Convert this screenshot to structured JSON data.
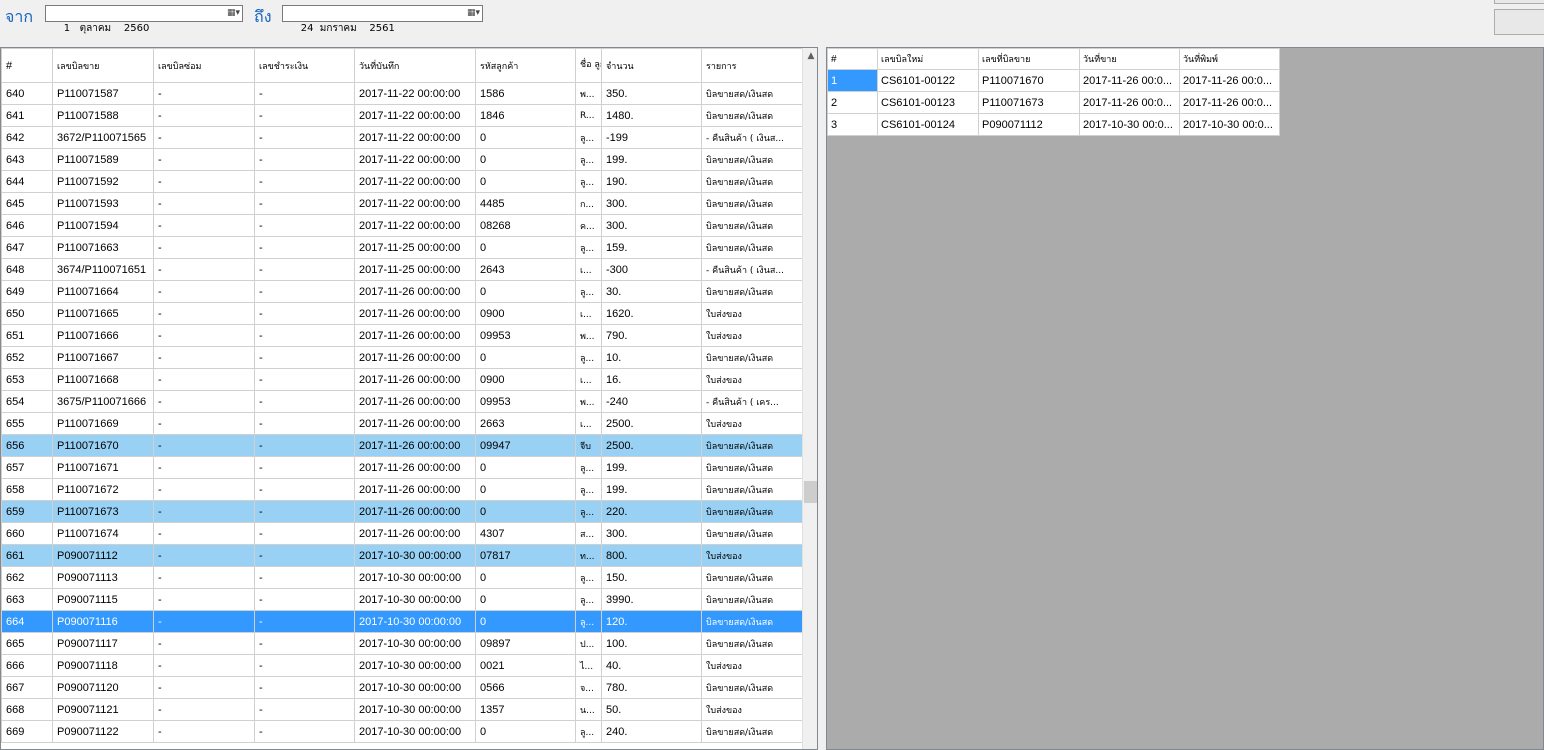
{
  "filter": {
    "from_label": "จาก",
    "from_date": "1   ตุลาคม    2560",
    "to_label": "ถึง",
    "to_date": "24  มกราคม    2561",
    "cal_icon": "▦▾"
  },
  "left_table": {
    "headers": [
      "#",
      "เลขบิลขาย",
      "เลขบิลซ่อม",
      "เลขชำระเงิน",
      "วันที่บันทึก",
      "รหัสลูกค้า",
      "ชื่อ ลูกค้",
      "จำนวน",
      "รายการ"
    ],
    "rows": [
      [
        "640",
        "P110071587",
        "-",
        "-",
        "2017-11-22 00:00:00",
        "1586",
        "พ...",
        "350.",
        "บิลขายสด/เงินสด"
      ],
      [
        "641",
        "P110071588",
        "-",
        "-",
        "2017-11-22 00:00:00",
        "1846",
        "R...",
        "1480.",
        "บิลขายสด/เงินสด"
      ],
      [
        "642",
        "3672/P110071565",
        "-",
        "-",
        "2017-11-22 00:00:00",
        "0",
        "ลู...",
        "-199",
        "- คืนสินค้า ( เงินส..."
      ],
      [
        "643",
        "P110071589",
        "-",
        "-",
        "2017-11-22 00:00:00",
        "0",
        "ลู...",
        "199.",
        "บิลขายสด/เงินสด"
      ],
      [
        "644",
        "P110071592",
        "-",
        "-",
        "2017-11-22 00:00:00",
        "0",
        "ลู...",
        "190.",
        "บิลขายสด/เงินสด"
      ],
      [
        "645",
        "P110071593",
        "-",
        "-",
        "2017-11-22 00:00:00",
        "4485",
        "ก...",
        "300.",
        "บิลขายสด/เงินสด"
      ],
      [
        "646",
        "P110071594",
        "-",
        "-",
        "2017-11-22 00:00:00",
        "08268",
        "ค...",
        "300.",
        "บิลขายสด/เงินสด"
      ],
      [
        "647",
        "P110071663",
        "-",
        "-",
        "2017-11-25 00:00:00",
        "0",
        "ลู...",
        "159.",
        "บิลขายสด/เงินสด"
      ],
      [
        "648",
        "3674/P110071651",
        "-",
        "-",
        "2017-11-25 00:00:00",
        "2643",
        "เ...",
        "-300",
        "- คืนสินค้า ( เงินส..."
      ],
      [
        "649",
        "P110071664",
        "-",
        "-",
        "2017-11-26 00:00:00",
        "0",
        "ลู...",
        "30.",
        "บิลขายสด/เงินสด"
      ],
      [
        "650",
        "P110071665",
        "-",
        "-",
        "2017-11-26 00:00:00",
        "0900",
        "เ...",
        "1620.",
        "ใบส่งของ"
      ],
      [
        "651",
        "P110071666",
        "-",
        "-",
        "2017-11-26 00:00:00",
        "09953",
        "พ...",
        "790.",
        "ใบส่งของ"
      ],
      [
        "652",
        "P110071667",
        "-",
        "-",
        "2017-11-26 00:00:00",
        "0",
        "ลู...",
        "10.",
        "บิลขายสด/เงินสด"
      ],
      [
        "653",
        "P110071668",
        "-",
        "-",
        "2017-11-26 00:00:00",
        "0900",
        "เ...",
        "16.",
        "ใบส่งของ"
      ],
      [
        "654",
        "3675/P110071666",
        "-",
        "-",
        "2017-11-26 00:00:00",
        "09953",
        "พ...",
        "-240",
        "- คืนสินค้า ( เคร..."
      ],
      [
        "655",
        "P110071669",
        "-",
        "-",
        "2017-11-26 00:00:00",
        "2663",
        "เ...",
        "2500.",
        "ใบส่งของ"
      ],
      [
        "656",
        "P110071670",
        "-",
        "-",
        "2017-11-26 00:00:00",
        "09947",
        "จีบ",
        "2500.",
        "บิลขายสด/เงินสด"
      ],
      [
        "657",
        "P110071671",
        "-",
        "-",
        "2017-11-26 00:00:00",
        "0",
        "ลู...",
        "199.",
        "บิลขายสด/เงินสด"
      ],
      [
        "658",
        "P110071672",
        "-",
        "-",
        "2017-11-26 00:00:00",
        "0",
        "ลู...",
        "199.",
        "บิลขายสด/เงินสด"
      ],
      [
        "659",
        "P110071673",
        "-",
        "-",
        "2017-11-26 00:00:00",
        "0",
        "ลู...",
        "220.",
        "บิลขายสด/เงินสด"
      ],
      [
        "660",
        "P110071674",
        "-",
        "-",
        "2017-11-26 00:00:00",
        "4307",
        "ส...",
        "300.",
        "บิลขายสด/เงินสด"
      ],
      [
        "661",
        "P090071112",
        "-",
        "-",
        "2017-10-30 00:00:00",
        "07817",
        "ท...",
        "800.",
        "ใบส่งของ"
      ],
      [
        "662",
        "P090071113",
        "-",
        "-",
        "2017-10-30 00:00:00",
        "0",
        "ลู...",
        "150.",
        "บิลขายสด/เงินสด"
      ],
      [
        "663",
        "P090071115",
        "-",
        "-",
        "2017-10-30 00:00:00",
        "0",
        "ลู...",
        "3990.",
        "บิลขายสด/เงินสด"
      ],
      [
        "664",
        "P090071116",
        "-",
        "-",
        "2017-10-30 00:00:00",
        "0",
        "ลู...",
        "120.",
        "บิลขายสด/เงินสด"
      ],
      [
        "665",
        "P090071117",
        "-",
        "-",
        "2017-10-30 00:00:00",
        "09897",
        "ป...",
        "100.",
        "บิลขายสด/เงินสด"
      ],
      [
        "666",
        "P090071118",
        "-",
        "-",
        "2017-10-30 00:00:00",
        "0021",
        "ไ...",
        "40.",
        "ใบส่งของ"
      ],
      [
        "667",
        "P090071120",
        "-",
        "-",
        "2017-10-30 00:00:00",
        "0566",
        "จ...",
        "780.",
        "บิลขายสด/เงินสด"
      ],
      [
        "668",
        "P090071121",
        "-",
        "-",
        "2017-10-30 00:00:00",
        "1357",
        "น...",
        "50.",
        "ใบส่งของ"
      ],
      [
        "669",
        "P090071122",
        "-",
        "-",
        "2017-10-30 00:00:00",
        "0",
        "ลู...",
        "240.",
        "บิลขายสด/เงินสด"
      ]
    ],
    "selected_light": [
      "656",
      "659",
      "661"
    ],
    "selected_dark": [
      "664"
    ]
  },
  "right_table": {
    "headers": [
      "#",
      "เลขบิลใหม่",
      "เลขที่บิลขาย",
      "วันที่ขาย",
      "วันที่พิมพ์"
    ],
    "rows": [
      [
        "1",
        "CS6101-00122",
        "P110071670",
        "2017-11-26 00:0...",
        "2017-11-26 00:0..."
      ],
      [
        "2",
        "CS6101-00123",
        "P110071673",
        "2017-11-26 00:0...",
        "2017-11-26 00:0..."
      ],
      [
        "3",
        "CS6101-00124",
        "P090071112",
        "2017-10-30 00:0...",
        "2017-10-30 00:0..."
      ]
    ],
    "selected_dark": [
      "1"
    ]
  },
  "colors": {
    "selection_light": "#99d1f5",
    "selection_dark": "#3399ff",
    "label_blue": "#1565c0",
    "empty_area": "#ababab"
  }
}
